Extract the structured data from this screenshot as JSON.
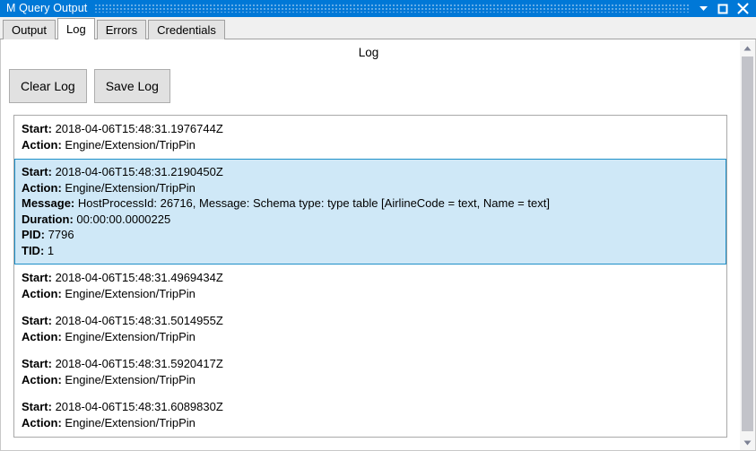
{
  "window": {
    "title": "M Query Output",
    "accent_color": "#0078d7",
    "buttons": [
      {
        "name": "minimize",
        "glyph": "chevron-down"
      },
      {
        "name": "maximize",
        "glyph": "square"
      },
      {
        "name": "close",
        "glyph": "x"
      }
    ]
  },
  "tabs": [
    {
      "label": "Output",
      "selected": false
    },
    {
      "label": "Log",
      "selected": true
    },
    {
      "label": "Errors",
      "selected": false
    },
    {
      "label": "Credentials",
      "selected": false
    }
  ],
  "page": {
    "heading": "Log"
  },
  "toolbar": {
    "clear_log_label": "Clear Log",
    "save_log_label": "Save Log"
  },
  "log": {
    "selected_index": 1,
    "selection_bg": "#cfe8f7",
    "selection_border": "#1e90c8",
    "entries": [
      {
        "selected": false,
        "fields": [
          {
            "label": "Start:",
            "value": "2018-04-06T15:48:31.1976744Z"
          },
          {
            "label": "Action:",
            "value": "Engine/Extension/TripPin"
          }
        ]
      },
      {
        "selected": true,
        "fields": [
          {
            "label": "Start:",
            "value": "2018-04-06T15:48:31.2190450Z"
          },
          {
            "label": "Action:",
            "value": "Engine/Extension/TripPin"
          },
          {
            "label": "Message:",
            "value": "HostProcessId: 26716, Message: Schema type: type table [AirlineCode = text, Name = text]"
          },
          {
            "label": "Duration:",
            "value": "00:00:00.0000225"
          },
          {
            "label": "PID:",
            "value": "7796"
          },
          {
            "label": "TID:",
            "value": "1"
          }
        ]
      },
      {
        "selected": false,
        "fields": [
          {
            "label": "Start:",
            "value": "2018-04-06T15:48:31.4969434Z"
          },
          {
            "label": "Action:",
            "value": "Engine/Extension/TripPin"
          }
        ]
      },
      {
        "selected": false,
        "fields": [
          {
            "label": "Start:",
            "value": "2018-04-06T15:48:31.5014955Z"
          },
          {
            "label": "Action:",
            "value": "Engine/Extension/TripPin"
          }
        ]
      },
      {
        "selected": false,
        "fields": [
          {
            "label": "Start:",
            "value": "2018-04-06T15:48:31.5920417Z"
          },
          {
            "label": "Action:",
            "value": "Engine/Extension/TripPin"
          }
        ]
      },
      {
        "selected": false,
        "fields": [
          {
            "label": "Start:",
            "value": "2018-04-06T15:48:31.6089830Z"
          },
          {
            "label": "Action:",
            "value": "Engine/Extension/TripPin"
          }
        ]
      }
    ]
  },
  "scrollbar": {
    "up_arrow": "▲",
    "down_arrow": "▼",
    "thumb_color": "#c2c3c9",
    "track_color": "#f5f5f5"
  }
}
